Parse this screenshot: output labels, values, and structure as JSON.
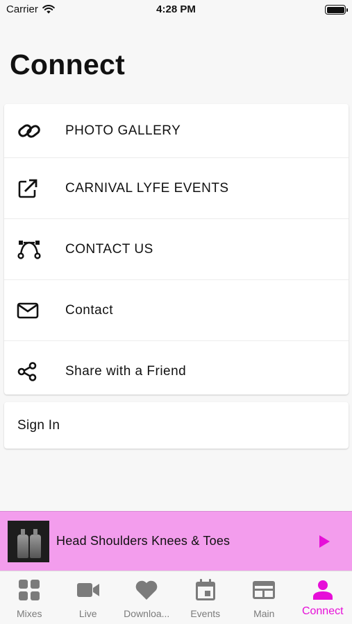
{
  "status_bar": {
    "carrier": "Carrier",
    "time": "4:28 PM"
  },
  "page": {
    "title": "Connect"
  },
  "menu": {
    "items": [
      {
        "label": "PHOTO GALLERY",
        "icon": "link-icon"
      },
      {
        "label": "CARNIVAL LYFE EVENTS",
        "icon": "external-link-icon"
      },
      {
        "label": "CONTACT US",
        "icon": "vector-curve-icon"
      },
      {
        "label": "Contact",
        "icon": "mail-icon"
      },
      {
        "label": "Share with a Friend",
        "icon": "share-icon"
      }
    ]
  },
  "signin": {
    "label": "Sign In"
  },
  "player": {
    "track_title": "Head Shoulders Knees & Toes",
    "accent": "#e60fd8",
    "background": "#f39ded"
  },
  "tabs": [
    {
      "label": "Mixes",
      "icon": "grid-icon",
      "active": false
    },
    {
      "label": "Live",
      "icon": "video-camera-icon",
      "active": false
    },
    {
      "label": "Downloa...",
      "icon": "heart-icon",
      "active": false
    },
    {
      "label": "Events",
      "icon": "calendar-icon",
      "active": false
    },
    {
      "label": "Main",
      "icon": "browser-window-icon",
      "active": false
    },
    {
      "label": "Connect",
      "icon": "person-icon",
      "active": true
    }
  ],
  "colors": {
    "active_tab": "#e60fd8",
    "inactive_tab": "#7b7b7b"
  }
}
